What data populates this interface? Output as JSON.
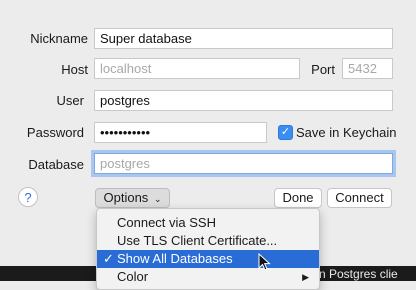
{
  "form": {
    "nickname_label": "Nickname",
    "nickname_value": "Super database",
    "host_label": "Host",
    "host_placeholder": "localhost",
    "port_label": "Port",
    "port_placeholder": "5432",
    "user_label": "User",
    "user_value": "postgres",
    "password_label": "Password",
    "password_value": "•••••••••••",
    "save_keychain_label": "Save in Keychain",
    "save_keychain_checked": true,
    "database_label": "Database",
    "database_placeholder": "postgres"
  },
  "buttons": {
    "help": "?",
    "options": "Options",
    "done": "Done",
    "connect": "Connect"
  },
  "options_menu": {
    "items": [
      {
        "label": "Connect via SSH",
        "checked": false,
        "selected": false,
        "submenu": false
      },
      {
        "label": "Use TLS Client Certificate...",
        "checked": false,
        "selected": false,
        "submenu": false
      },
      {
        "label": "Show All Databases",
        "checked": true,
        "selected": true,
        "submenu": false
      },
      {
        "label": "Color",
        "checked": false,
        "selected": false,
        "submenu": true
      }
    ]
  },
  "background_window_text": "rn Postgres clie",
  "colors": {
    "accent": "#2a6cd6",
    "focus_ring": "#a9c6f0",
    "checkbox": "#3b8df1"
  }
}
